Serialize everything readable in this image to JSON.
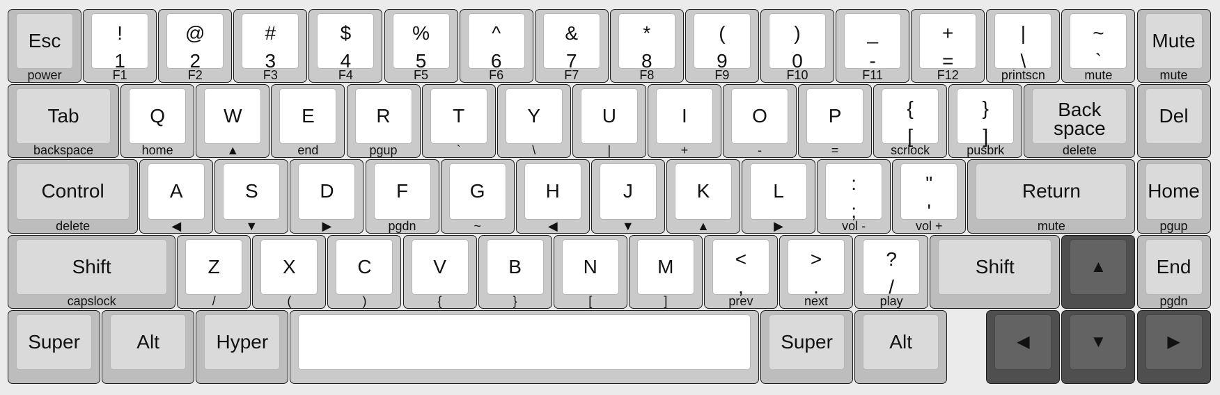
{
  "rows": [
    [
      {
        "id": "esc",
        "center": "Esc",
        "sub": "power",
        "w": 1,
        "style": "gray"
      },
      {
        "id": "1",
        "top": "!",
        "bot": "1",
        "sub": "F1",
        "w": 1,
        "style": "white"
      },
      {
        "id": "2",
        "top": "@",
        "bot": "2",
        "sub": "F2",
        "w": 1,
        "style": "white"
      },
      {
        "id": "3",
        "top": "#",
        "bot": "3",
        "sub": "F3",
        "w": 1,
        "style": "white"
      },
      {
        "id": "4",
        "top": "$",
        "bot": "4",
        "sub": "F4",
        "w": 1,
        "style": "white"
      },
      {
        "id": "5",
        "top": "%",
        "bot": "5",
        "sub": "F5",
        "w": 1,
        "style": "white"
      },
      {
        "id": "6",
        "top": "^",
        "bot": "6",
        "sub": "F6",
        "w": 1,
        "style": "white"
      },
      {
        "id": "7",
        "top": "&",
        "bot": "7",
        "sub": "F7",
        "w": 1,
        "style": "white"
      },
      {
        "id": "8",
        "top": "*",
        "bot": "8",
        "sub": "F8",
        "w": 1,
        "style": "white"
      },
      {
        "id": "9",
        "top": "(",
        "bot": "9",
        "sub": "F9",
        "w": 1,
        "style": "white"
      },
      {
        "id": "0",
        "top": ")",
        "bot": "0",
        "sub": "F10",
        "w": 1,
        "style": "white"
      },
      {
        "id": "minus",
        "top": "_",
        "bot": "-",
        "sub": "F11",
        "w": 1,
        "style": "white"
      },
      {
        "id": "equal",
        "top": "+",
        "bot": "=",
        "sub": "F12",
        "w": 1,
        "style": "white"
      },
      {
        "id": "backslash",
        "top": "|",
        "bot": "\\",
        "sub": "printscn",
        "w": 1,
        "style": "white"
      },
      {
        "id": "grave",
        "top": "~",
        "bot": "`",
        "sub": "mute",
        "w": 1,
        "style": "white"
      },
      {
        "id": "mute",
        "center": "Mute",
        "sub": "mute",
        "w": 1,
        "style": "gray"
      }
    ],
    [
      {
        "id": "tab",
        "center": "Tab",
        "sub": "backspace",
        "w": 1.5,
        "style": "gray"
      },
      {
        "id": "q",
        "center": "Q",
        "sub": "home",
        "w": 1,
        "style": "white"
      },
      {
        "id": "w",
        "center": "W",
        "sub": "▲",
        "w": 1,
        "style": "white"
      },
      {
        "id": "e",
        "center": "E",
        "sub": "end",
        "w": 1,
        "style": "white"
      },
      {
        "id": "r",
        "center": "R",
        "sub": "pgup",
        "w": 1,
        "style": "white"
      },
      {
        "id": "t",
        "center": "T",
        "sub": "`",
        "w": 1,
        "style": "white"
      },
      {
        "id": "y",
        "center": "Y",
        "sub": "\\",
        "w": 1,
        "style": "white"
      },
      {
        "id": "u",
        "center": "U",
        "sub": "|",
        "w": 1,
        "style": "white"
      },
      {
        "id": "i",
        "center": "I",
        "sub": "+",
        "w": 1,
        "style": "white"
      },
      {
        "id": "o",
        "center": "O",
        "sub": "-",
        "w": 1,
        "style": "white"
      },
      {
        "id": "p",
        "center": "P",
        "sub": "=",
        "w": 1,
        "style": "white"
      },
      {
        "id": "lbracket",
        "top": "{",
        "bot": "[",
        "sub": "scrlock",
        "w": 1,
        "style": "white"
      },
      {
        "id": "rbracket",
        "top": "}",
        "bot": "]",
        "sub": "pusbrk",
        "w": 1,
        "style": "white"
      },
      {
        "id": "backspace",
        "line1": "Back",
        "line2": "space",
        "sub": "delete",
        "w": 1.5,
        "style": "gray"
      },
      {
        "id": "del",
        "center": "Del",
        "w": 1,
        "style": "gray"
      }
    ],
    [
      {
        "id": "control",
        "center": "Control",
        "sub": "delete",
        "w": 1.75,
        "style": "gray"
      },
      {
        "id": "a",
        "center": "A",
        "sub": "◀",
        "w": 1,
        "style": "white"
      },
      {
        "id": "s",
        "center": "S",
        "sub": "▼",
        "w": 1,
        "style": "white"
      },
      {
        "id": "d",
        "center": "D",
        "sub": "▶",
        "w": 1,
        "style": "white"
      },
      {
        "id": "f",
        "center": "F",
        "sub": "pgdn",
        "w": 1,
        "style": "white"
      },
      {
        "id": "g",
        "center": "G",
        "sub": "~",
        "w": 1,
        "style": "white"
      },
      {
        "id": "h",
        "center": "H",
        "sub": "◀",
        "w": 1,
        "style": "white"
      },
      {
        "id": "j",
        "center": "J",
        "sub": "▼",
        "w": 1,
        "style": "white"
      },
      {
        "id": "k",
        "center": "K",
        "sub": "▲",
        "w": 1,
        "style": "white"
      },
      {
        "id": "l",
        "center": "L",
        "sub": "▶",
        "w": 1,
        "style": "white"
      },
      {
        "id": "semicolon",
        "top": ":",
        "bot": ";",
        "sub": "vol -",
        "w": 1,
        "style": "white"
      },
      {
        "id": "quote",
        "top": "\"",
        "bot": "'",
        "sub": "vol +",
        "w": 1,
        "style": "white"
      },
      {
        "id": "return",
        "center": "Return",
        "sub": "mute",
        "w": 2.25,
        "style": "gray"
      },
      {
        "id": "home",
        "center": "Home",
        "sub": "pgup",
        "w": 1,
        "style": "gray"
      }
    ],
    [
      {
        "id": "lshift",
        "center": "Shift",
        "sub": "capslock",
        "w": 2.25,
        "style": "gray"
      },
      {
        "id": "z",
        "center": "Z",
        "sub": "/",
        "w": 1,
        "style": "white"
      },
      {
        "id": "x",
        "center": "X",
        "sub": "(",
        "w": 1,
        "style": "white"
      },
      {
        "id": "c",
        "center": "C",
        "sub": ")",
        "w": 1,
        "style": "white"
      },
      {
        "id": "v",
        "center": "V",
        "sub": "{",
        "w": 1,
        "style": "white"
      },
      {
        "id": "b",
        "center": "B",
        "sub": "}",
        "w": 1,
        "style": "white"
      },
      {
        "id": "n",
        "center": "N",
        "sub": "[",
        "w": 1,
        "style": "white"
      },
      {
        "id": "m",
        "center": "M",
        "sub": "]",
        "w": 1,
        "style": "white"
      },
      {
        "id": "comma",
        "top": "<",
        "bot": ",",
        "sub": "prev",
        "w": 1,
        "style": "white"
      },
      {
        "id": "period",
        "top": ">",
        "bot": ".",
        "sub": "next",
        "w": 1,
        "style": "white"
      },
      {
        "id": "slash",
        "top": "?",
        "bot": "/",
        "sub": "play",
        "w": 1,
        "style": "white"
      },
      {
        "id": "rshift",
        "center": "Shift",
        "w": 1.75,
        "style": "gray"
      },
      {
        "id": "up",
        "center": "▲",
        "w": 1,
        "style": "dark",
        "icon": "arrow-up-icon"
      },
      {
        "id": "end",
        "center": "End",
        "sub": "pgdn",
        "w": 1,
        "style": "gray"
      }
    ],
    [
      {
        "id": "lsuper",
        "center": "Super",
        "w": 1.25,
        "style": "gray"
      },
      {
        "id": "lalt",
        "center": "Alt",
        "w": 1.25,
        "style": "gray"
      },
      {
        "id": "hyper",
        "center": "Hyper",
        "w": 1.25,
        "style": "gray"
      },
      {
        "id": "space",
        "center": "",
        "w": 6.25,
        "style": "white"
      },
      {
        "id": "rsuper",
        "center": "Super",
        "w": 1.25,
        "style": "gray"
      },
      {
        "id": "ralt",
        "center": "Alt",
        "w": 1.25,
        "style": "gray"
      },
      {
        "id": "gap",
        "gap": true,
        "w": 0.5
      },
      {
        "id": "left",
        "center": "◀",
        "w": 1,
        "style": "dark",
        "icon": "arrow-left-icon"
      },
      {
        "id": "down",
        "center": "▼",
        "w": 1,
        "style": "dark",
        "icon": "arrow-down-icon"
      },
      {
        "id": "right",
        "center": "▶",
        "w": 1,
        "style": "dark",
        "icon": "arrow-right-icon"
      }
    ]
  ]
}
